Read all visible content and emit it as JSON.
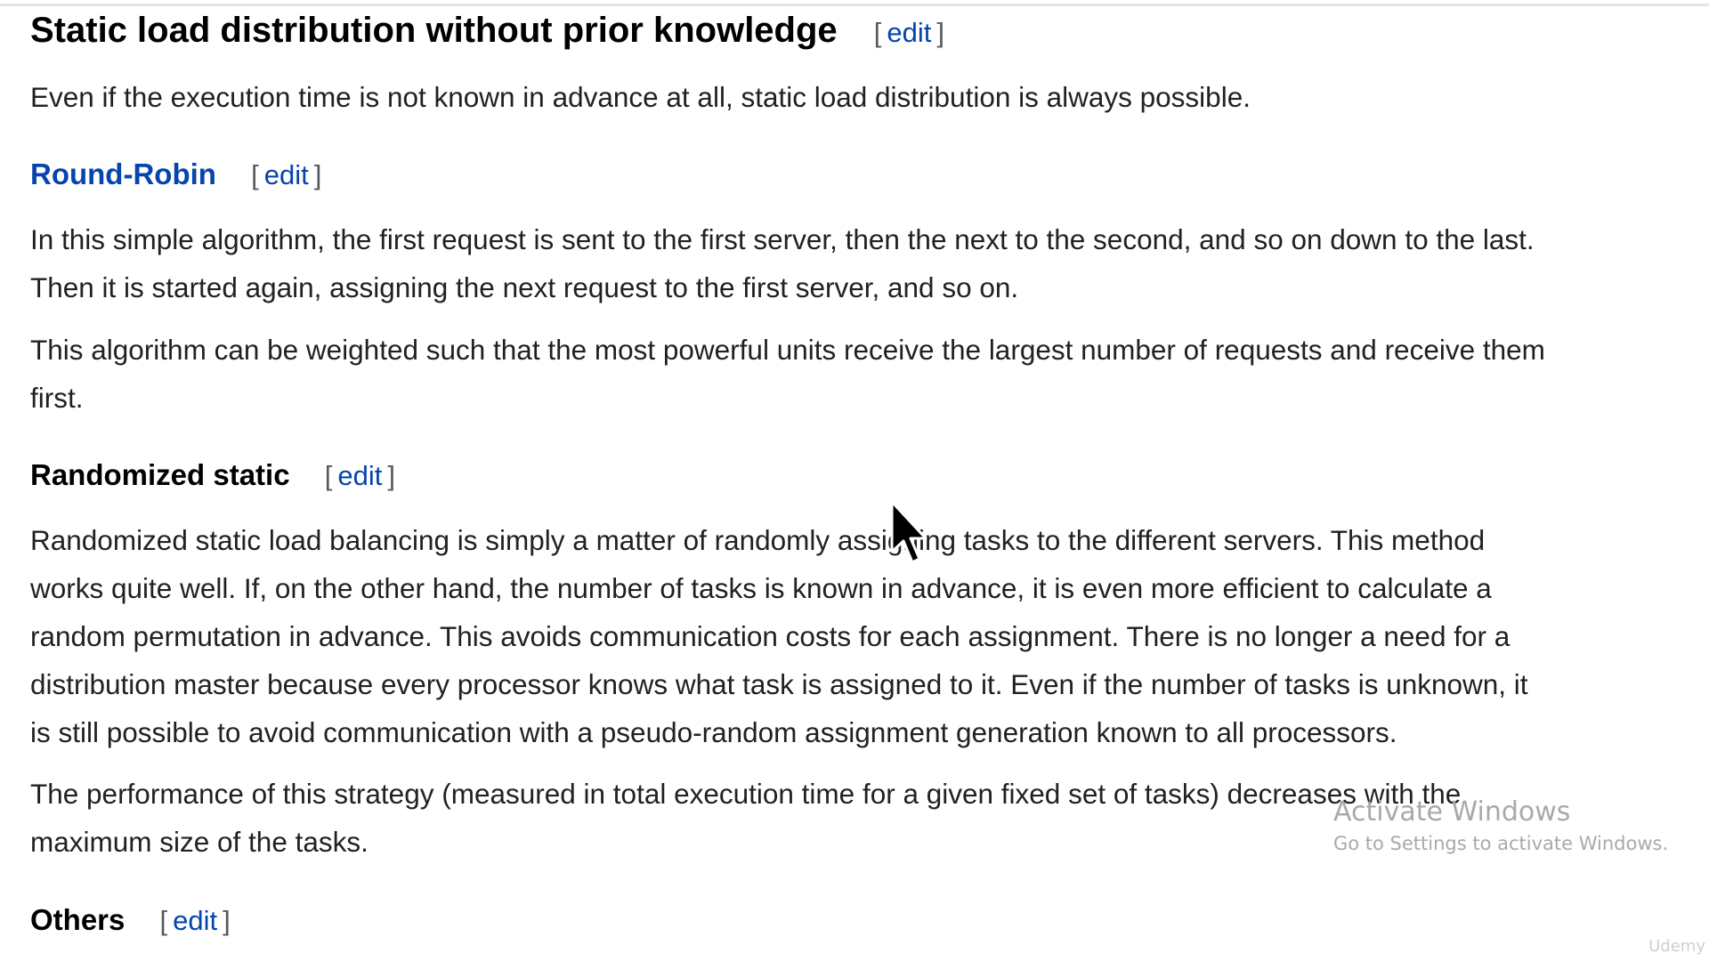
{
  "headings": {
    "main": "Static load distribution without prior knowledge",
    "round_robin": "Round-Robin",
    "randomized": "Randomized static",
    "others": "Others"
  },
  "edit": {
    "open_bracket": "[",
    "label": "edit",
    "close_bracket": "]"
  },
  "paragraphs": {
    "intro": [
      "Even if the execution time is not known in advance at all, static load distribution is always possible."
    ],
    "rr1": [
      "In this simple algorithm, the first request is sent to the first server, then the next to the second, and so on down to the last.",
      "Then it is started again, assigning the next request to the first server, and so on."
    ],
    "rr2": [
      "This algorithm can be weighted such that the most powerful units receive the largest number of requests and receive them",
      "first."
    ],
    "rand1": [
      "Randomized static load balancing is simply a matter of randomly assigning tasks to the different servers. This method",
      "works quite well. If, on the other hand, the number of tasks is known in advance, it is even more efficient to calculate a",
      "random permutation in advance. This avoids communication costs for each assignment. There is no longer a need for a",
      "distribution master because every processor knows what task is assigned to it. Even if the number of tasks is unknown, it",
      "is still possible to avoid communication with a pseudo-random assignment generation known to all processors."
    ],
    "rand2": [
      "The performance of this strategy (measured in total execution time for a given fixed set of tasks) decreases with the",
      "maximum size of the tasks."
    ]
  },
  "watermark": {
    "title": "Activate Windows",
    "subtitle": "Go to Settings to activate Windows."
  },
  "logo": "Udemy",
  "icons": {
    "cursor": "mouse-pointer-icon"
  },
  "colors": {
    "text": "#202122",
    "heading": "#000000",
    "link": "#0645ad",
    "bracket": "#54595d",
    "watermark": "#a9a9a9"
  }
}
